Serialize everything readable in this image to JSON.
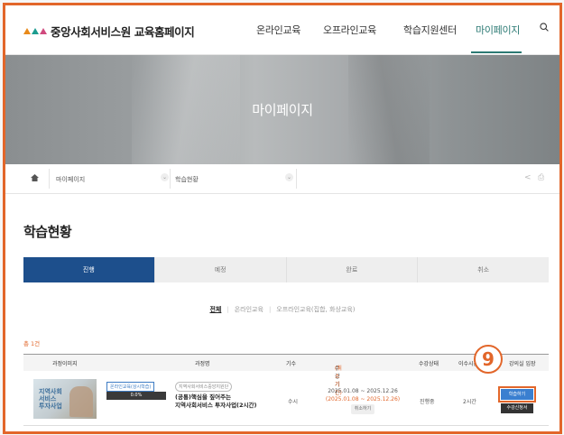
{
  "header": {
    "logo_text": "중앙사회서비스원 교육홈페이지",
    "nav": [
      "온라인교육",
      "오프라인교육",
      "학습지원센터",
      "마이페이지"
    ],
    "active_nav": "마이페이지"
  },
  "banner": {
    "title": "마이페이지"
  },
  "breadcrumb": {
    "level1": "마이페이지",
    "level2": "학습현황"
  },
  "page_title": "학습현황",
  "tabs": [
    "진행",
    "예정",
    "완료",
    "취소"
  ],
  "active_tab": "진행",
  "filters": [
    "전체",
    "온라인교육",
    "오프라인교육(집합, 화상교육)"
  ],
  "count_text": "총 1건",
  "table": {
    "headers": [
      "과정이미지",
      "과정명",
      "기수",
      "수강기간",
      "(취소기간)",
      "수강상태",
      "이수시간",
      "강의실 입장"
    ],
    "row": {
      "thumb_title": "지역사회\n서비스\n투자사업",
      "category_badge": "온라인교육(상시학습)",
      "org_badge": "지역사회서비스중앙지원단",
      "progress": "0.0%",
      "progress_value": 0,
      "course_line1": "(공통)핵심을 짚어주는",
      "course_line2": "지역사회서비스 투자사업(2시간)",
      "round": "수시",
      "period": "2025.01.08 ~ 2025.12.26",
      "cancel_period": "(2025.01.08 ~ 2025.12.26)",
      "cancel_button": "취소하기",
      "status": "진행중",
      "hours": "2시간",
      "study_button": "학습하기",
      "cert_button": "수강신청서"
    }
  },
  "callout": "9",
  "colors": {
    "accent": "#e2662a",
    "active_tab": "#1d4f8c",
    "nav_active": "#2c7a74",
    "study_button": "#3a7fd0"
  }
}
